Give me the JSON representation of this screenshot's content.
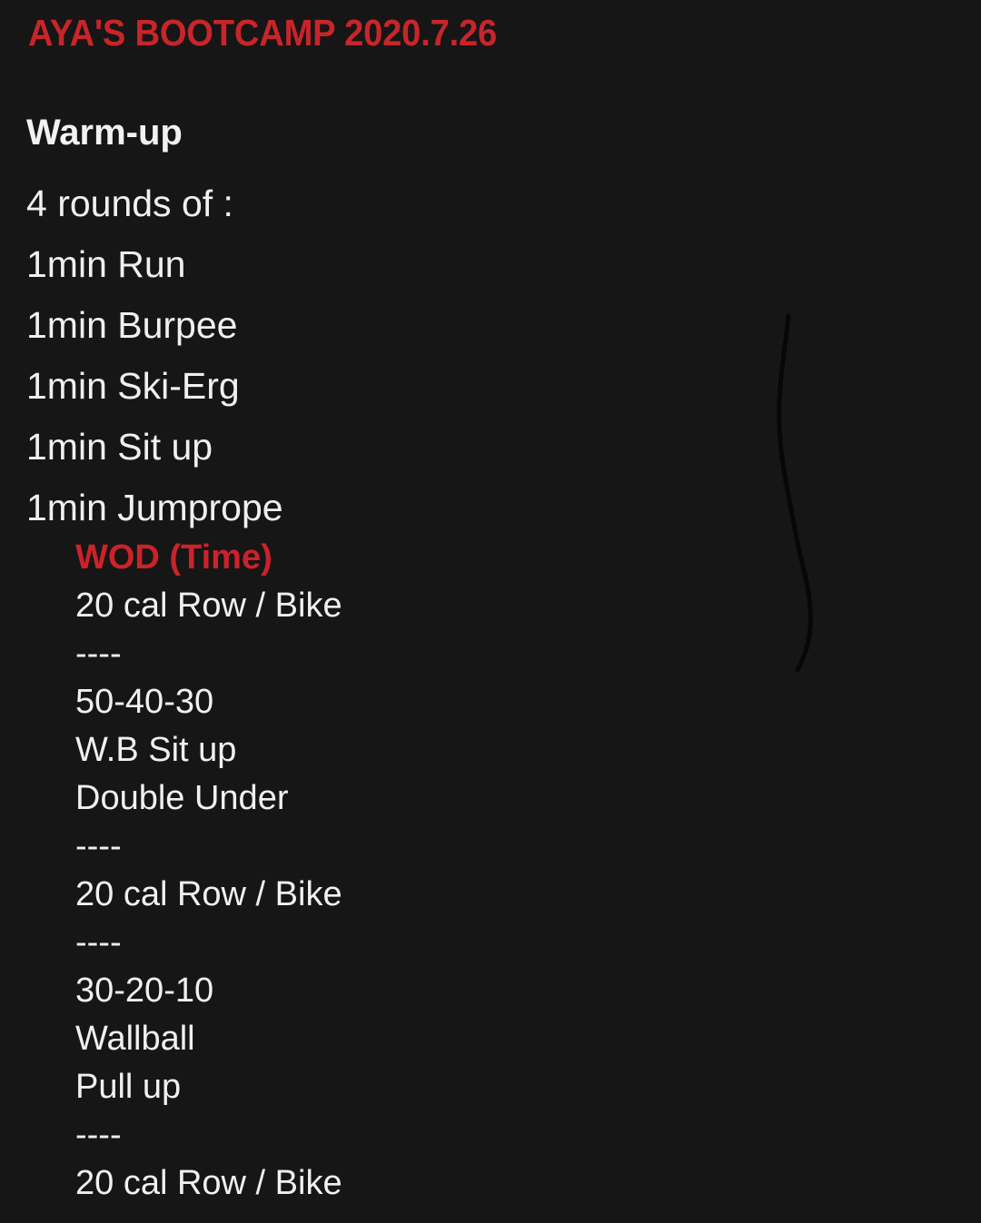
{
  "colors": {
    "background": "#161616",
    "accent_red": "#c8252a",
    "text_white": "#f0f0f0"
  },
  "title": "AYA'S BOOTCAMP 2020.7.26",
  "warmup": {
    "heading": "Warm-up",
    "lines": [
      "4 rounds of :",
      "1min Run",
      "1min Burpee",
      "1min Ski-Erg",
      "1min Sit up",
      "1min Jumprope"
    ]
  },
  "wod": {
    "heading": "WOD (Time)",
    "lines": [
      "20 cal Row / Bike",
      "----",
      "50-40-30",
      "W.B Sit up",
      "Double Under",
      "----",
      "20 cal Row / Bike",
      "----",
      "30-20-10",
      "Wallball",
      "Pull up",
      "----",
      "20 cal Row / Bike"
    ]
  }
}
